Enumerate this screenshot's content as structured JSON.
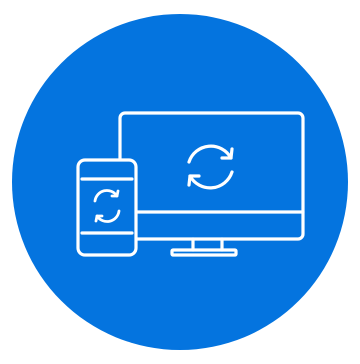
{
  "badge": {
    "icon": "device-sync-icon",
    "background_color": "#0474DF",
    "foreground_color": "#FFFFFF",
    "page_background": "#FFFFFF"
  },
  "devices": {
    "monitor": {
      "icon": "desktop-monitor-icon",
      "sync_icon": "sync-arrows-icon"
    },
    "phone": {
      "icon": "smartphone-icon",
      "sync_icon": "sync-arrows-icon"
    }
  }
}
